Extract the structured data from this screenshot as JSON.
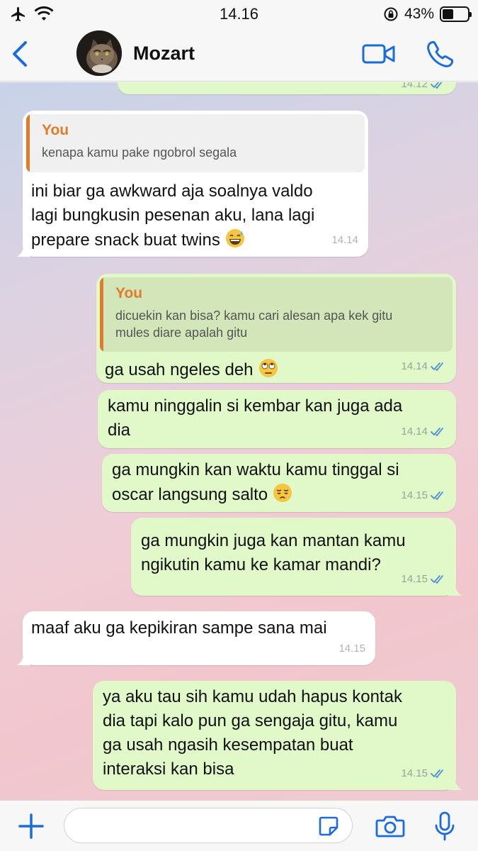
{
  "status": {
    "time": "14.16",
    "battery": "43%",
    "battery_level": 0.43
  },
  "header": {
    "contact_name": "Mozart"
  },
  "colors": {
    "accent": "#1a6be0",
    "outgoing_bubble": "#e1f8c9",
    "incoming_bubble": "#ffffff",
    "quote_author": "#e07b2a",
    "read_ticks": "#4a8fd8"
  },
  "messages": [
    {
      "dir": "out",
      "time": "14.12",
      "text": ""
    },
    {
      "dir": "in",
      "time": "14.14",
      "reply_to": {
        "author": "You",
        "text": "kenapa kamu pake ngobrol segala"
      },
      "text": "ini biar ga awkward aja soalnya valdo\nlagi bungkusin pesenan aku, lana lagi\nprepare snack buat twins",
      "emoji": "grinning-sweat-emoji"
    },
    {
      "dir": "out",
      "time": "14.14",
      "reply_to": {
        "author": "You",
        "text": "dicuekin kan bisa? kamu cari alesan apa kek gitu\nmules diare apalah gitu"
      },
      "text": "ga usah ngeles deh",
      "emoji": "eye-roll-emoji"
    },
    {
      "dir": "out",
      "time": "14.14",
      "text": "kamu ninggalin si kembar kan juga ada\ndia"
    },
    {
      "dir": "out",
      "time": "14.15",
      "text": "ga mungkin kan waktu kamu tinggal si\noscar langsung salto",
      "emoji": "pensive-emoji"
    },
    {
      "dir": "out",
      "time": "14.15",
      "text": "ga mungkin juga kan mantan kamu\nngikutin kamu ke kamar mandi?"
    },
    {
      "dir": "in",
      "time": "14.15",
      "text": "maaf aku ga kepikiran sampe sana mai"
    },
    {
      "dir": "out",
      "time": "14.15",
      "text": "ya aku tau sih kamu udah hapus kontak\ndia tapi kalo pun ga sengaja gitu, kamu\nga usah ngasih kesempatan buat\ninteraksi kan bisa"
    }
  ],
  "input": {
    "placeholder": ""
  }
}
